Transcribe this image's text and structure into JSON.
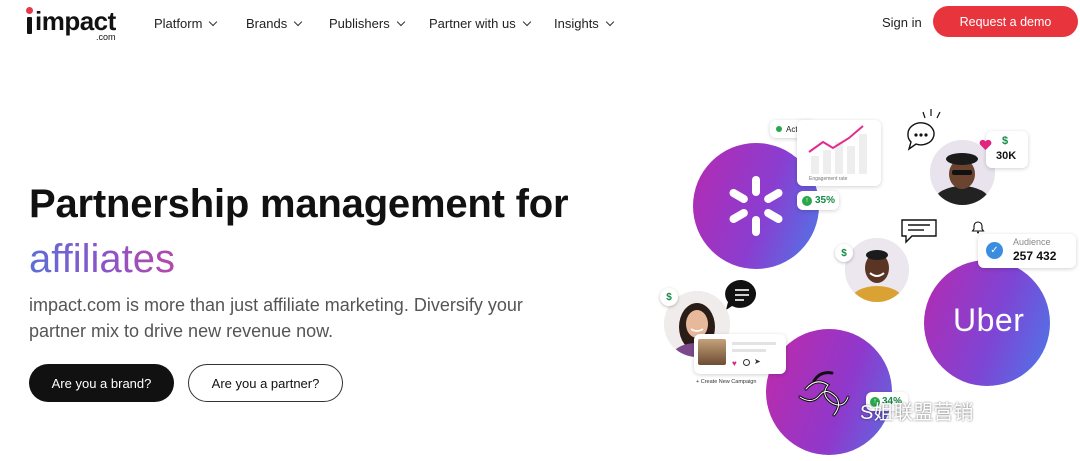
{
  "nav": {
    "logo_word": "impact",
    "logo_sub": ".com",
    "items": [
      {
        "label": "Platform"
      },
      {
        "label": "Brands"
      },
      {
        "label": "Publishers"
      },
      {
        "label": "Partner with us"
      },
      {
        "label": "Insights"
      }
    ],
    "signin": "Sign in",
    "demo": "Request a demo"
  },
  "hero": {
    "title_line1": "Partnership management for",
    "title_line2": "affiliates",
    "subtitle": "impact.com is more than just affiliate marketing. Diversify your partner mix to drive new revenue now.",
    "btn_brand": "Are you a brand?",
    "btn_partner": "Are you a partner?"
  },
  "illustration": {
    "active_label": "Active",
    "engagement_label": "Engagement rate",
    "stat_35": "35%",
    "stat_30k": "30K",
    "dollar": "$",
    "audience_label": "Audience",
    "audience_value": "257 432",
    "uber": "Uber",
    "stat_34": "34%",
    "create_campaign": "+ Create New Campaign",
    "watermark": "S姐联盟营销",
    "colors": {
      "accent": "#e8343d",
      "gradient_start": "#b52ab0",
      "gradient_end": "#4b79e8",
      "green": "#28a84a"
    }
  }
}
